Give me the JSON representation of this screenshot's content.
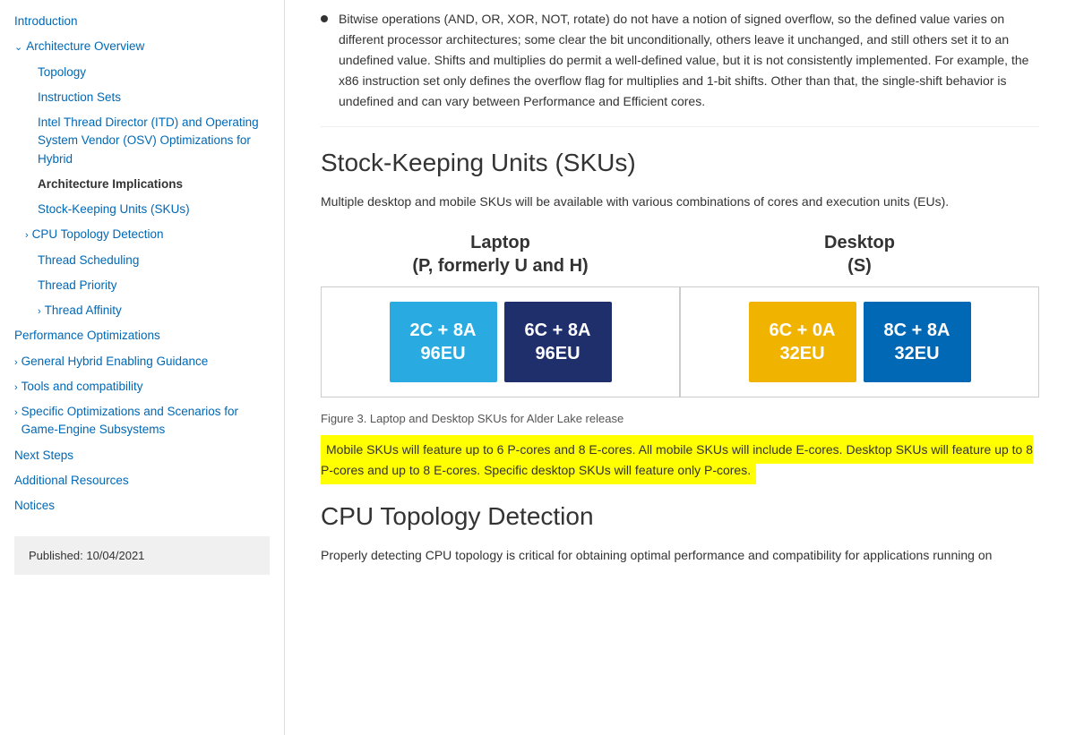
{
  "sidebar": {
    "items": [
      {
        "id": "introduction",
        "label": "Introduction",
        "indent": 0,
        "active": false,
        "type": "link"
      },
      {
        "id": "architecture-overview",
        "label": "Architecture Overview",
        "indent": 0,
        "active": false,
        "type": "expandable",
        "expanded": true
      },
      {
        "id": "topology",
        "label": "Topology",
        "indent": 1,
        "active": false,
        "type": "link"
      },
      {
        "id": "instruction-sets",
        "label": "Instruction Sets",
        "indent": 1,
        "active": false,
        "type": "link"
      },
      {
        "id": "intel-thread-director",
        "label": "Intel Thread Director (ITD) and Operating System Vendor (OSV) Optimizations for Hybrid",
        "indent": 1,
        "active": false,
        "type": "link"
      },
      {
        "id": "architecture-implications",
        "label": "Architecture Implications",
        "indent": 1,
        "active": true,
        "type": "link"
      },
      {
        "id": "stock-keeping-units",
        "label": "Stock-Keeping Units (SKUs)",
        "indent": 1,
        "active": false,
        "type": "link"
      },
      {
        "id": "cpu-topology-detection",
        "label": "CPU Topology Detection",
        "indent": 0,
        "active": false,
        "type": "expandable",
        "expanded": false
      },
      {
        "id": "thread-scheduling",
        "label": "Thread Scheduling",
        "indent": 1,
        "active": false,
        "type": "link"
      },
      {
        "id": "thread-priority",
        "label": "Thread Priority",
        "indent": 1,
        "active": false,
        "type": "link"
      },
      {
        "id": "thread-affinity",
        "label": "Thread Affinity",
        "indent": 1,
        "active": false,
        "type": "expandable"
      },
      {
        "id": "performance-optimizations",
        "label": "Performance Optimizations",
        "indent": 0,
        "active": false,
        "type": "link"
      },
      {
        "id": "general-hybrid-enabling",
        "label": "General Hybrid Enabling Guidance",
        "indent": 0,
        "active": false,
        "type": "expandable"
      },
      {
        "id": "tools-compatibility",
        "label": "Tools and compatibility",
        "indent": 0,
        "active": false,
        "type": "expandable"
      },
      {
        "id": "specific-optimizations",
        "label": "Specific Optimizations and Scenarios for Game-Engine Subsystems",
        "indent": 0,
        "active": false,
        "type": "expandable"
      },
      {
        "id": "next-steps",
        "label": "Next Steps",
        "indent": 0,
        "active": false,
        "type": "link"
      },
      {
        "id": "additional-resources",
        "label": "Additional Resources",
        "indent": 0,
        "active": false,
        "type": "link"
      },
      {
        "id": "notices",
        "label": "Notices",
        "indent": 0,
        "active": false,
        "type": "link"
      }
    ],
    "published_label": "Published:",
    "published_date": "10/04/2021"
  },
  "main": {
    "top_bullet": "Bitwise operations (AND, OR, XOR, NOT, rotate) do not have a notion of signed overflow, so the defined value varies on different processor architectures; some clear the bit unconditionally, others leave it unchanged, and still others set it to an undefined value. Shifts and multiplies do permit a well-defined value, but it is not consistently implemented. For example, the x86 instruction set only defines the overflow flag for multiplies and 1-bit shifts. Other than that, the single-shift behavior is undefined and can vary between Performance and Efficient cores.",
    "sku_heading": "Stock-Keeping Units (SKUs)",
    "sku_subtext": "Multiple desktop and mobile SKUs will be available with various combinations of cores and execution units (EUs).",
    "laptop_group": {
      "title_line1": "Laptop",
      "title_line2": "(P, formerly U and H)"
    },
    "desktop_group": {
      "title_line1": "Desktop",
      "title_line2": "(S)"
    },
    "sku_boxes": [
      {
        "label": "2C + 8A\n96EU",
        "color": "cyan"
      },
      {
        "label": "6C + 8A\n96EU",
        "color": "dark-blue"
      },
      {
        "label": "6C + 0A\n32EU",
        "color": "gold"
      },
      {
        "label": "8C + 8A\n32EU",
        "color": "blue"
      }
    ],
    "figure_caption": "Figure 3. Laptop and Desktop SKUs for Alder Lake release",
    "highlight_text": "Mobile SKUs will feature up to 6 P-cores and 8 E-cores. All mobile SKUs will include E-cores. Desktop SKUs will feature up to 8 P-cores and up to 8 E-cores. Specific desktop SKUs will feature only P-cores.",
    "cpu_topology_heading": "CPU Topology Detection",
    "cpu_topology_text": "Properly detecting CPU topology is critical for obtaining optimal performance and compatibility for applications running on"
  }
}
